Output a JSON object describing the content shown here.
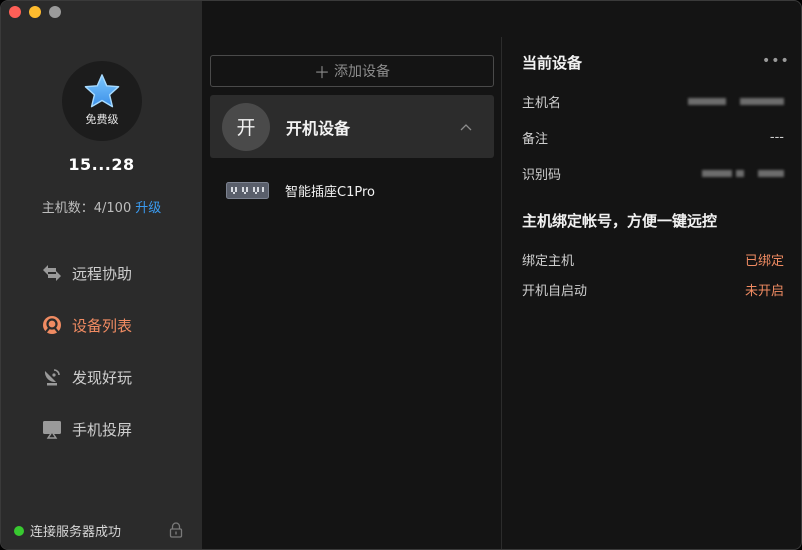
{
  "sidebar": {
    "avatar_tier": "免费级",
    "username": "15...28",
    "host_count_label": "主机数：4/100",
    "upgrade_label": "升级",
    "nav": [
      {
        "label": "远程协助",
        "icon": "remote-assist-icon",
        "active": false
      },
      {
        "label": "设备列表",
        "icon": "device-list-icon",
        "active": true
      },
      {
        "label": "发现好玩",
        "icon": "satellite-dish-icon",
        "active": false
      },
      {
        "label": "手机投屏",
        "icon": "screen-cast-icon",
        "active": false
      }
    ],
    "status_text": "连接服务器成功"
  },
  "devices": {
    "add_button_label": "添加设备",
    "group": {
      "avatar_char": "开",
      "name": "开机设备"
    },
    "items": [
      {
        "name": "智能插座C1Pro",
        "icon": "smart-plug-icon"
      }
    ]
  },
  "detail": {
    "title": "当前设备",
    "more": "•••",
    "host_name_label": "主机名",
    "note_label": "备注",
    "note_value": "---",
    "id_label": "识别码",
    "bind_section_title": "主机绑定帐号，方便一键远控",
    "bind_host_label": "绑定主机",
    "bind_host_value": "已绑定",
    "autostart_label": "开机自启动",
    "autostart_value": "未开启"
  },
  "colors": {
    "accent_orange": "#f08b62",
    "link_blue": "#3a9bf0",
    "status_green": "#38c930",
    "sidebar_bg": "#2b2b2b",
    "main_bg": "#141414"
  }
}
